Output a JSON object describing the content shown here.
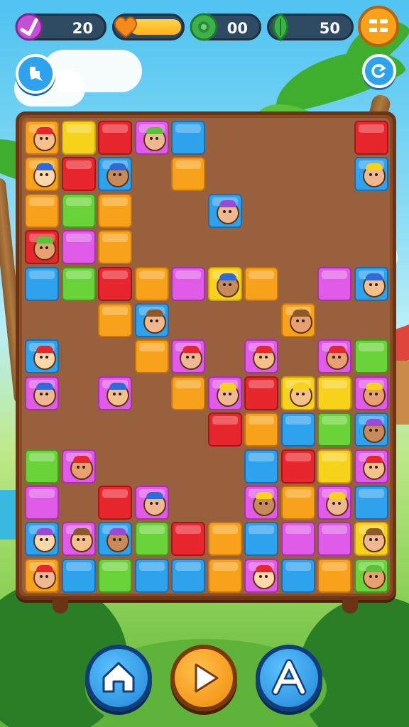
{
  "hud": {
    "level_label": "20",
    "coins_label": "00",
    "gems_label": "50",
    "lives_fraction": 1.0
  },
  "icons": {
    "level": "pencil-icon",
    "lives": "heart-icon",
    "coins": "clover-icon",
    "gems": "leaf-gem-icon",
    "menu": "menu-icon",
    "left_top": "puzzle-icon",
    "right_top": "refresh-icon",
    "home": "home-icon",
    "play": "play-icon",
    "hint": "letter-a-icon"
  },
  "colors": {
    "red": "#e8262e",
    "yellow": "#f7d21a",
    "orange": "#f7a21a",
    "blue": "#2ea2ec",
    "green": "#6ad33a",
    "magenta": "#e05ce8"
  },
  "board": {
    "cols": 10,
    "rows": 13,
    "grid": [
      [
        "o*",
        "y",
        "r",
        "m*",
        "b",
        "",
        "",
        "",
        "",
        "r"
      ],
      [
        "o*",
        "r",
        "b*",
        "",
        "o",
        "",
        "",
        "",
        "",
        "b*"
      ],
      [
        "o",
        "g",
        "o",
        "",
        "",
        "b*",
        "",
        "",
        "",
        ""
      ],
      [
        "r*",
        "m",
        "o",
        "",
        "",
        "",
        "",
        "",
        "",
        ""
      ],
      [
        "b",
        "g",
        "r",
        "o",
        "m",
        "y*",
        "o",
        "",
        "m",
        "b*"
      ],
      [
        "",
        "",
        "o",
        "b*",
        "",
        "",
        "",
        "o*",
        "",
        ""
      ],
      [
        "b*",
        "",
        "",
        "o",
        "m*",
        "",
        "m*",
        "",
        "m*",
        "g"
      ],
      [
        "m*",
        "",
        "m*",
        "",
        "o",
        "m*",
        "r",
        "y*",
        "y",
        "m*"
      ],
      [
        "",
        "",
        "",
        "",
        "",
        "r",
        "o",
        "b",
        "g",
        "b*"
      ],
      [
        "g",
        "m*",
        "",
        "",
        "",
        "",
        "b",
        "r",
        "y",
        "m*"
      ],
      [
        "m",
        "",
        "r",
        "m*",
        "",
        "",
        "m*",
        "o",
        "m*",
        "b"
      ],
      [
        "b*",
        "m*",
        "b*",
        "g",
        "r",
        "o",
        "b",
        "m",
        "m",
        "y*"
      ],
      [
        "o*",
        "b",
        "g",
        "b",
        "b",
        "o",
        "m*",
        "b",
        "o",
        "g*"
      ]
    ]
  }
}
